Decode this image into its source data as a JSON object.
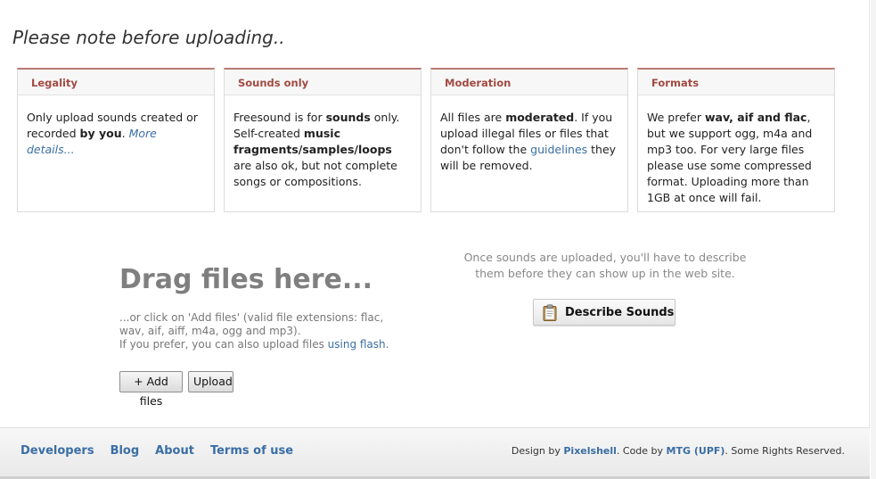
{
  "heading": "Please note before uploading..",
  "notes": [
    {
      "title": "Legality",
      "body": {
        "t1": "Only upload sounds created or recorded ",
        "b1": "by you",
        "t2": ". ",
        "link": "More details..."
      }
    },
    {
      "title": "Sounds only",
      "body": {
        "t1": "Freesound is for ",
        "b1": "sounds",
        "t2": " only. Self-created ",
        "b2": "music fragments/samples/loops",
        "t3": " are also ok, but not complete songs or compositions."
      }
    },
    {
      "title": "Moderation",
      "body": {
        "t1": "All files are ",
        "b1": "moderated",
        "t2": ". If you upload illegal files or files that don't follow the ",
        "link": "guidelines",
        "t3": " they will be removed."
      }
    },
    {
      "title": "Formats",
      "body": {
        "t1": "We prefer ",
        "b1": "wav, aif and flac",
        "t2": ", but we support ogg, m4a and mp3 too. For very large files please use some compressed format. Uploading more than 1GB at once will fail."
      }
    }
  ],
  "upload": {
    "drag_title": "Drag files here...",
    "help_line": "...or click on 'Add files' (valid file extensions: flac, wav, aif, aiff, m4a, ogg and mp3).",
    "flash_prefix": "If you prefer, you can also upload files ",
    "flash_link": "using flash",
    "flash_suffix": ".",
    "add_files_label": "+ Add files",
    "upload_label": "Upload"
  },
  "describe": {
    "text": "Once sounds are uploaded, you'll have to describe them before they can show up in the web site.",
    "button_label": "Describe Sounds",
    "icon": "clipboard-icon"
  },
  "footer": {
    "links": [
      "Developers",
      "Blog",
      "About",
      "Terms of use"
    ],
    "credit": {
      "t1": "Design by ",
      "design_link": "Pixelshell",
      "t2": ". Code by ",
      "code_link": "MTG (UPF)",
      "t3": ". Some Rights Reserved."
    }
  },
  "colors": {
    "note_title": "#a24a42",
    "note_accent": "#b97b73",
    "link": "#3a6ea5"
  }
}
